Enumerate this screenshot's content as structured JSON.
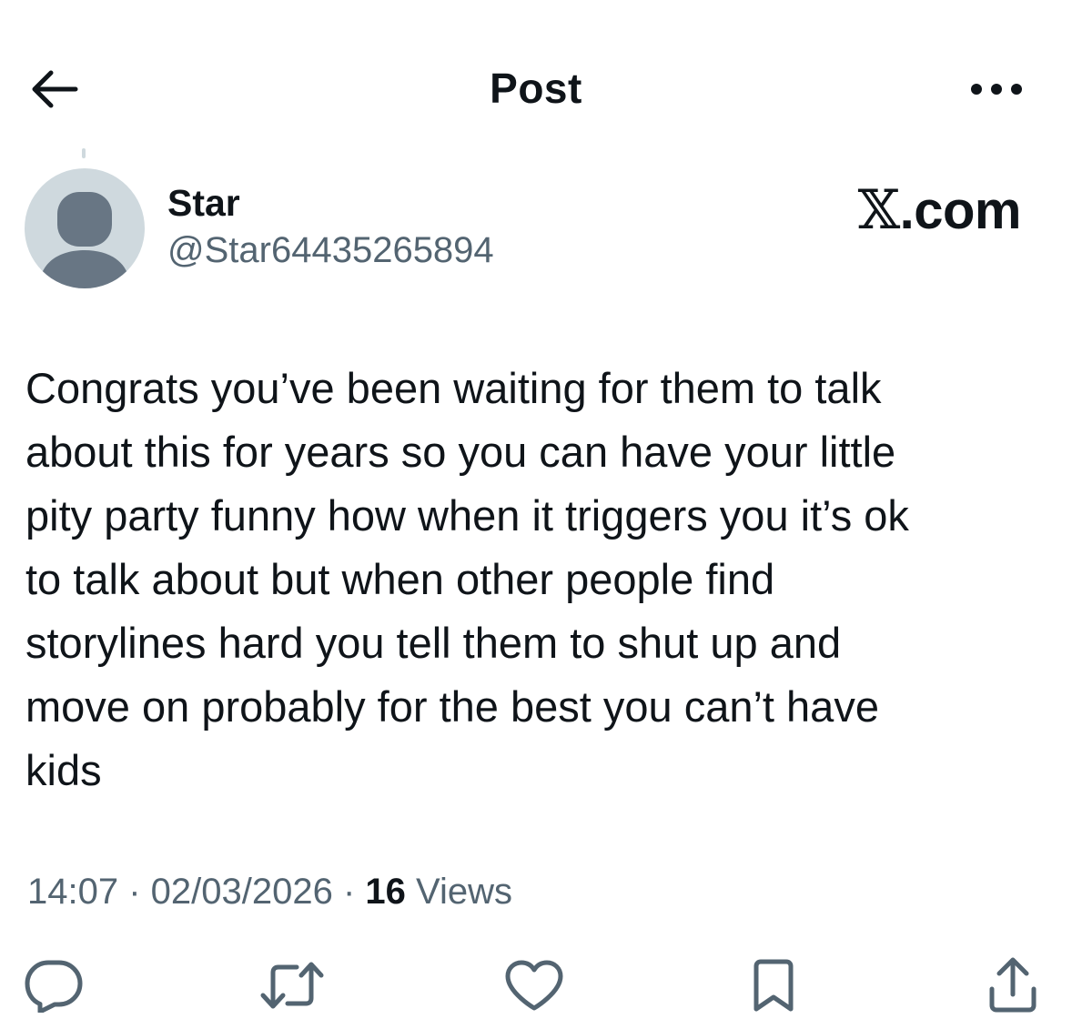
{
  "header": {
    "title": "Post",
    "back_icon": "arrow-left-icon",
    "more_icon": "more-dots-icon"
  },
  "author": {
    "name": "Star",
    "handle": "@Star64435265894",
    "avatar_icon": "default-avatar-icon"
  },
  "watermark": {
    "x_glyph": "𝕏",
    "domain": ".com"
  },
  "post": {
    "text": "Congrats you’ve been waiting for them to talk\nabout this for years so you can have your little\npity party funny how when it triggers you it’s ok\nto talk about but when other people find\nstorylines hard you tell them to shut up and\nmove on probably for the best you can’t have\nkids"
  },
  "meta": {
    "time": "14:07",
    "separator": " · ",
    "date": "02/03/2026",
    "views_count": "16",
    "views_label": " Views"
  },
  "actions": [
    {
      "name": "reply",
      "icon": "reply-icon"
    },
    {
      "name": "repost",
      "icon": "repost-icon"
    },
    {
      "name": "like",
      "icon": "heart-icon"
    },
    {
      "name": "bookmark",
      "icon": "bookmark-icon"
    },
    {
      "name": "share",
      "icon": "share-icon"
    }
  ],
  "colors": {
    "text": "#0f1419",
    "secondary": "#536471",
    "avatar_bg": "#cfd9de",
    "avatar_fg": "#687684"
  }
}
